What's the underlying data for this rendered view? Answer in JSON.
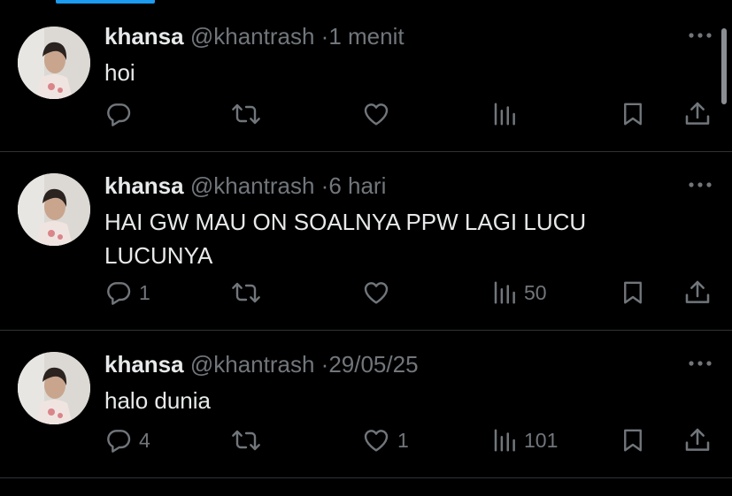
{
  "tweets": [
    {
      "name": "khansa",
      "handle": "@khantrash",
      "separator": "·",
      "time": "1 menit",
      "text": "hoi",
      "replies": "",
      "likes": "",
      "views": ""
    },
    {
      "name": "khansa",
      "handle": "@khantrash",
      "separator": "·",
      "time": "6 hari",
      "text": "HAI GW MAU ON SOALNYA PPW LAGI LUCU LUCUNYA",
      "replies": "1",
      "likes": "",
      "views": "50"
    },
    {
      "name": "khansa",
      "handle": "@khantrash",
      "separator": "·",
      "time": "29/05/25",
      "text": "halo dunia",
      "replies": "4",
      "likes": "1",
      "views": "101"
    }
  ],
  "icons": {
    "reply": "reply-icon",
    "retweet": "retweet-icon",
    "like": "heart-icon",
    "views": "views-icon",
    "bookmark": "bookmark-icon",
    "share": "share-icon",
    "more": "more-icon"
  },
  "colors": {
    "background": "#000000",
    "text": "#e7e9ea",
    "muted": "#71767b",
    "accent": "#1d9bf0",
    "divider": "#2f3336"
  }
}
